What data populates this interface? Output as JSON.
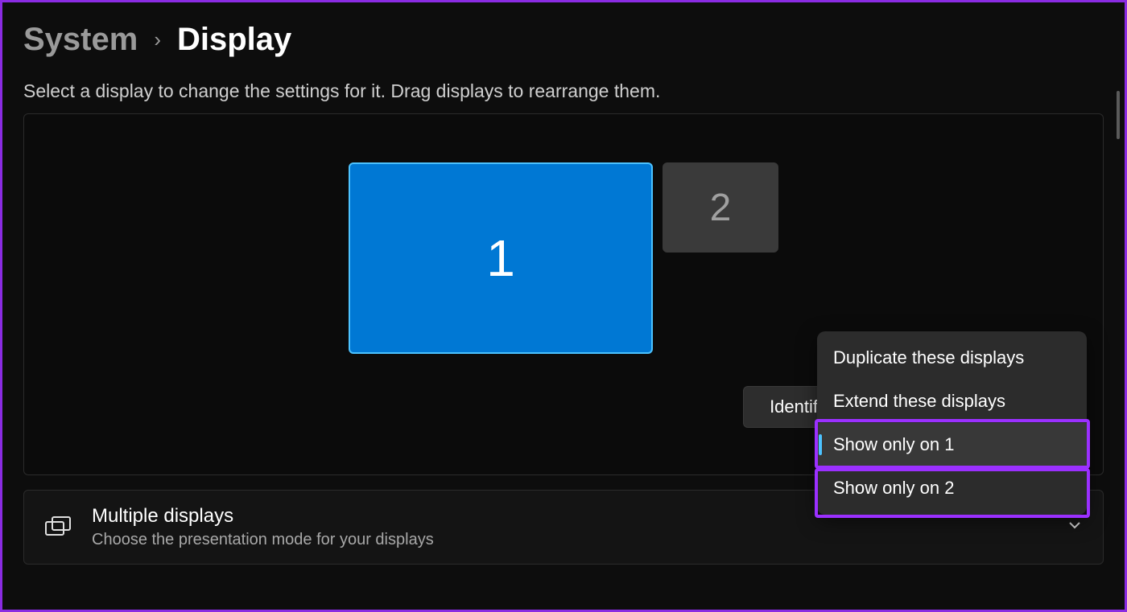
{
  "breadcrumb": {
    "parent": "System",
    "current": "Display"
  },
  "instruction": "Select a display to change the settings for it. Drag displays to rearrange them.",
  "displays": {
    "primary_label": "1",
    "secondary_label": "2"
  },
  "buttons": {
    "identify": "Identify"
  },
  "projection_menu": {
    "duplicate": "Duplicate these displays",
    "extend": "Extend these displays",
    "show_only_1": "Show only on 1",
    "show_only_2": "Show only on 2"
  },
  "sections": {
    "multiple_displays": {
      "title": "Multiple displays",
      "subtitle": "Choose the presentation mode for your displays"
    }
  }
}
